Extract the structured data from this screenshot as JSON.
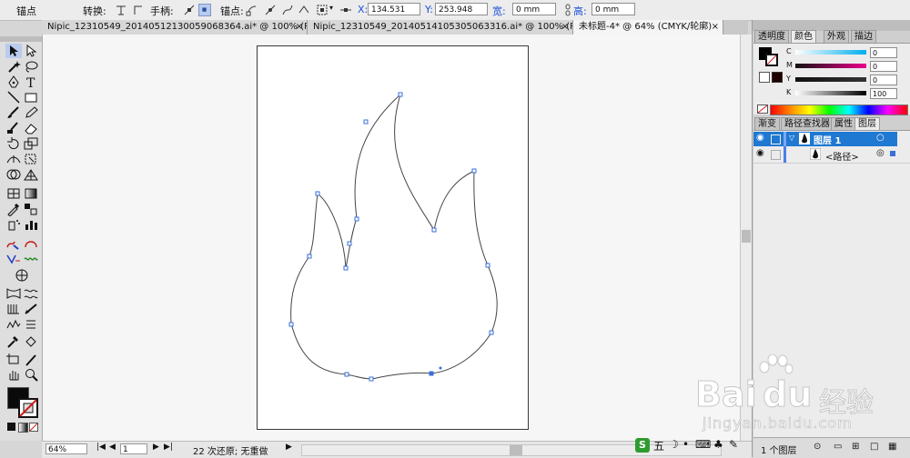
{
  "control_bar": {
    "anchor_label": "锚点",
    "convert_label": "转换:",
    "handle_label": "手柄:",
    "anchor_point_label": "锚点:",
    "x_label": "X:",
    "x_value": "134.531 mm",
    "y_label": "Y:",
    "y_value": "253.948 mm",
    "w_label": "宽:",
    "w_value": "0 mm",
    "h_label": "高:",
    "h_value": "0 mm"
  },
  "doc_tabs": [
    {
      "label": "Nipic_12310549_20140512130059068364.ai* @ 100% (R...",
      "close": "×"
    },
    {
      "label": "Nipic_12310549_20140514105305063316.ai* @ 100% (R...",
      "close": "×"
    },
    {
      "label": "未标题-4* @ 64% (CMYK/轮廓)",
      "close": "×"
    }
  ],
  "status_bar": {
    "zoom": "64%",
    "artboard_num": "1",
    "undo_text": "22 次还原; 无重做"
  },
  "color_panel": {
    "tabs": [
      "透明度",
      "颜色",
      "外观",
      "描边"
    ],
    "channels": [
      {
        "label": "C",
        "value": "0",
        "level": 0
      },
      {
        "label": "M",
        "value": "0",
        "level": 0
      },
      {
        "label": "Y",
        "value": "0",
        "level": 0
      },
      {
        "label": "K",
        "value": "100",
        "level": 100
      }
    ]
  },
  "layers_panel": {
    "tabs": [
      "渐变",
      "路径查找器",
      "属性",
      "图层"
    ],
    "layers": [
      {
        "name": "图层 1"
      },
      {
        "name": "<路径>"
      }
    ],
    "footer": "1 个图层"
  },
  "watermark": {
    "brand": "Bai",
    "brand2": "du",
    "cn": "经验",
    "url": "jingyan.baidu.com"
  },
  "tray": {
    "ime": "五"
  },
  "colors": {
    "selection_blue": "#3a6fd8",
    "layer_highlight": "#1f78d1"
  }
}
